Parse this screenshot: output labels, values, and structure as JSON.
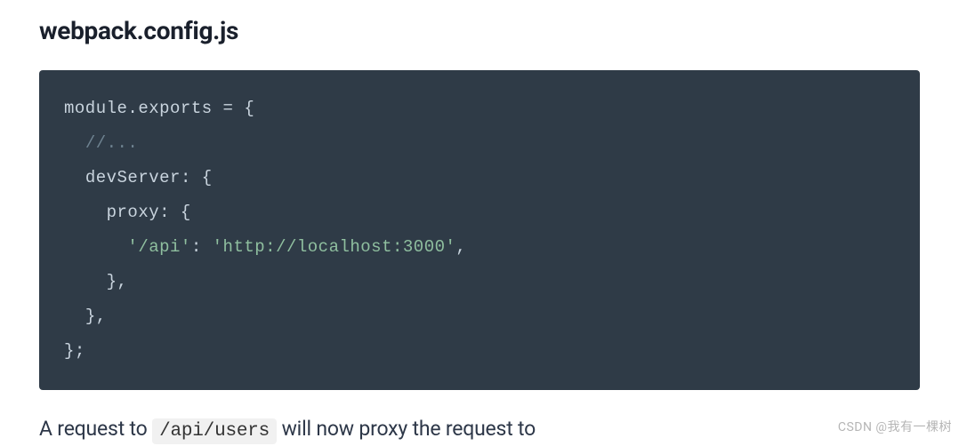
{
  "heading": "webpack.config.js",
  "code": {
    "l1_a": "module",
    "l1_b": ".exports ",
    "l1_c": "=",
    "l1_d": " {",
    "l2_indent": "  ",
    "l2_comment": "//...",
    "l3_indent": "  ",
    "l3_key": "devServer",
    "l3_colon": ":",
    "l3_brace": " {",
    "l4_indent": "    ",
    "l4_key": "proxy",
    "l4_colon": ":",
    "l4_brace": " {",
    "l5_indent": "      ",
    "l5_key": "'/api'",
    "l5_colon": ":",
    "l5_space": " ",
    "l5_value": "'http://localhost:3000'",
    "l5_comma": ",",
    "l6_indent": "    ",
    "l6_close": "},",
    "l7_indent": "  ",
    "l7_close": "},",
    "l8_close": "};"
  },
  "body": {
    "pre": "A request to ",
    "code": "/api/users",
    "post": " will now proxy the request to"
  },
  "watermark": "CSDN @我有一棵树"
}
